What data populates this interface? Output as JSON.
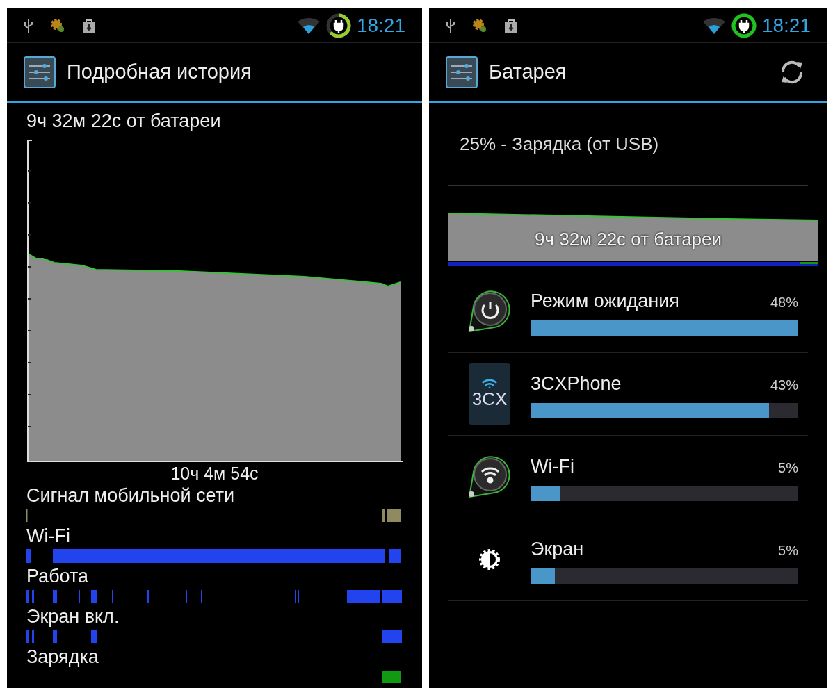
{
  "left_screen": {
    "status_bar": {
      "time": "18:21"
    },
    "action_bar": {
      "title": "Подробная история"
    },
    "battery_time": "9ч 32м 22с от батареи",
    "total_time": "10ч 4м 54с",
    "timelines": [
      {
        "kind": "signal",
        "label": "Сигнал мобильной сети"
      },
      {
        "kind": "wifi",
        "label": "Wi-Fi"
      },
      {
        "kind": "awake",
        "label": "Работа"
      },
      {
        "kind": "screen",
        "label": "Экран вкл."
      },
      {
        "kind": "charging",
        "label": "Зарядка"
      }
    ]
  },
  "right_screen": {
    "status_bar": {
      "time": "18:21"
    },
    "action_bar": {
      "title": "Батарея"
    },
    "charge_status": "25% - Зарядка (от USB)",
    "graph_caption": "9ч 32м 22с от батареи",
    "items": [
      {
        "kind": "standby",
        "name": "Режим ожидания",
        "percent": "48%",
        "level": 1.0
      },
      {
        "kind": "app",
        "icon_text": "3CX",
        "name": "3CXPhone",
        "percent": "43%",
        "level": 0.89
      },
      {
        "kind": "wifi",
        "name": "Wi-Fi",
        "percent": "5%",
        "level": 0.11
      },
      {
        "kind": "screen",
        "name": "Экран",
        "percent": "5%",
        "level": 0.09
      }
    ]
  }
}
